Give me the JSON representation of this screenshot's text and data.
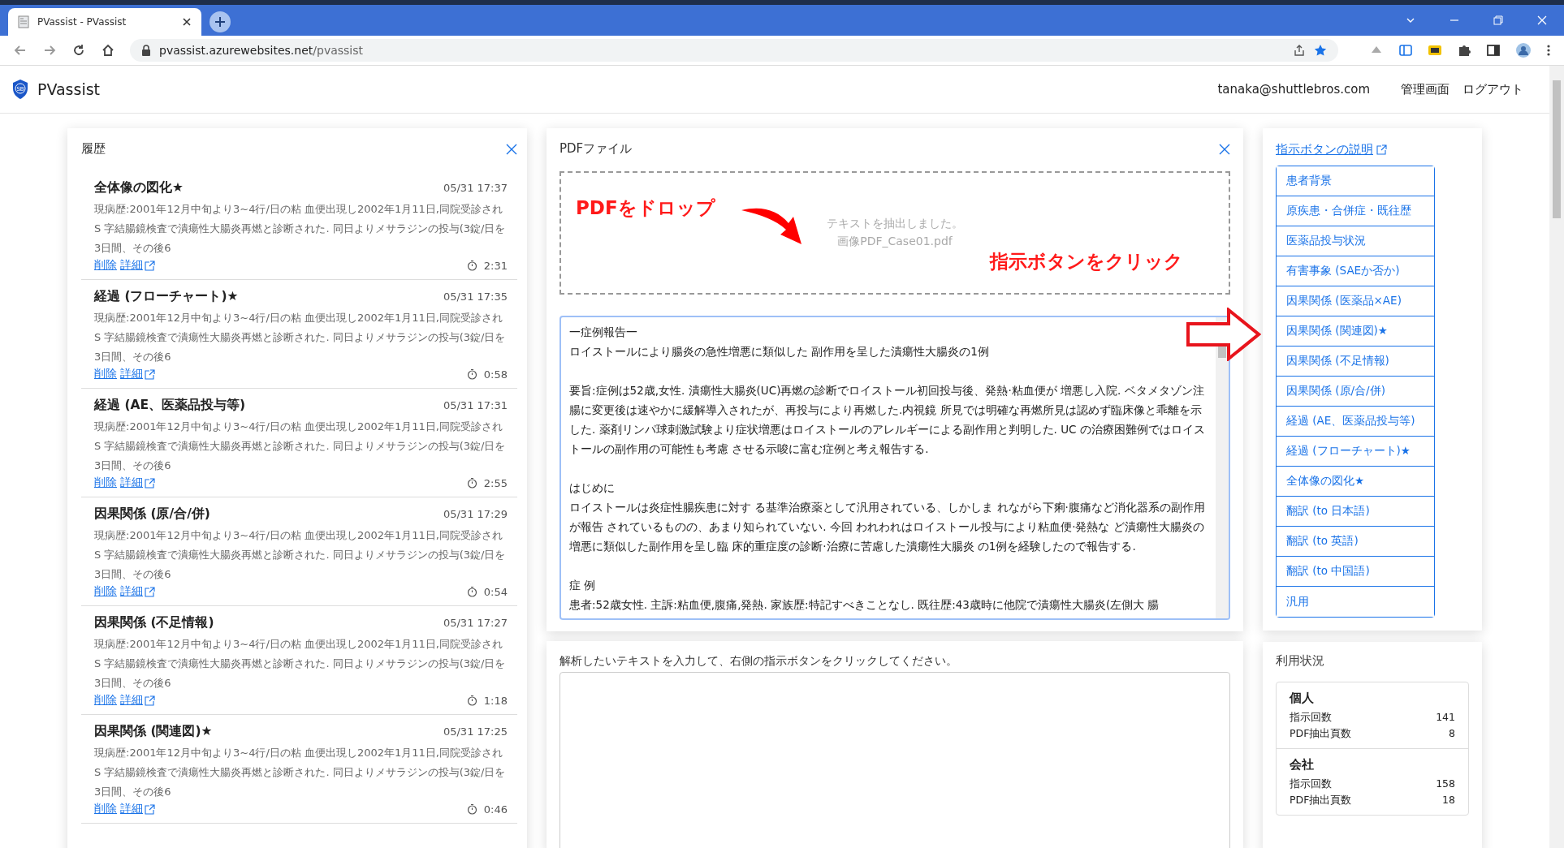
{
  "browser": {
    "tab_title": "PVassist - PVassist",
    "url_host": "pvassist.azurewebsites.net",
    "url_path": "/pvassist"
  },
  "header": {
    "logo_text": "SB",
    "app_name": "PVassist",
    "user": "tanaka@shuttlebros.com",
    "nav": [
      "管理画面",
      "ログアウト"
    ]
  },
  "history": {
    "title": "履歴",
    "items": [
      {
        "title": "全体像の図化★",
        "time": "05/31 17:37",
        "excerpt": "現病歴:2001年12月中旬より3~4行/日の粘 血便出現し2002年1月11日,同院受診され S 字結腸鏡検査で潰瘍性大腸炎再燃と診断された. 同日よりメサラジンの投与(3錠/日を3日間、その後6",
        "actions": [
          "削除",
          "詳細"
        ],
        "duration": "2:31"
      },
      {
        "title": "経過 (フローチャート)★",
        "time": "05/31 17:35",
        "excerpt": "現病歴:2001年12月中旬より3~4行/日の粘 血便出現し2002年1月11日,同院受診され S 字結腸鏡検査で潰瘍性大腸炎再燃と診断された. 同日よりメサラジンの投与(3錠/日を3日間、その後6",
        "actions": [
          "削除",
          "詳細"
        ],
        "duration": "0:58"
      },
      {
        "title": "経過 (AE、医薬品投与等)",
        "time": "05/31 17:31",
        "excerpt": "現病歴:2001年12月中旬より3~4行/日の粘 血便出現し2002年1月11日,同院受診され S 字結腸鏡検査で潰瘍性大腸炎再燃と診断された. 同日よりメサラジンの投与(3錠/日を3日間、その後6",
        "actions": [
          "削除",
          "詳細"
        ],
        "duration": "2:55"
      },
      {
        "title": "因果関係 (原/合/併)",
        "time": "05/31 17:29",
        "excerpt": "現病歴:2001年12月中旬より3~4行/日の粘 血便出現し2002年1月11日,同院受診され S 字結腸鏡検査で潰瘍性大腸炎再燃と診断された. 同日よりメサラジンの投与(3錠/日を3日間、その後6",
        "actions": [
          "削除",
          "詳細"
        ],
        "duration": "0:54"
      },
      {
        "title": "因果関係 (不足情報)",
        "time": "05/31 17:27",
        "excerpt": "現病歴:2001年12月中旬より3~4行/日の粘 血便出現し2002年1月11日,同院受診され S 字結腸鏡検査で潰瘍性大腸炎再燃と診断された. 同日よりメサラジンの投与(3錠/日を3日間、その後6",
        "actions": [
          "削除",
          "詳細"
        ],
        "duration": "1:18"
      },
      {
        "title": "因果関係 (関連図)★",
        "time": "05/31 17:25",
        "excerpt": "現病歴:2001年12月中旬より3~4行/日の粘 血便出現し2002年1月11日,同院受診され S 字結腸鏡検査で潰瘍性大腸炎再燃と診断された. 同日よりメサラジンの投与(3錠/日を3日間、その後6",
        "actions": [
          "削除",
          "詳細"
        ],
        "duration": "0:46"
      }
    ]
  },
  "pdf": {
    "title": "PDFファイル",
    "status": "テキストを抽出しました。",
    "filename": "画像PDF_Case01.pdf",
    "extracted_text": [
      [
        "一症例報告一",
        "ロイストールにより腸炎の急性増悪に類似した 副作用を呈した潰瘍性大腸炎の1例"
      ],
      [
        "要旨:症例は52歳,女性. 潰瘍性大腸炎(UC)再燃の診断でロイストール初回投与後、発熱·粘血便が 増悪し入院. ベタメタゾン注腸に変更後は速やかに緩解導入されたが、再投与により再燃した.内視鏡 所見では明確な再燃所見は認めず臨床像と乖離を示した. 薬剤リンパ球刺激試験より症状増悪はロイストールのアレルギーによる副作用と判明した. UC の治療困難例ではロイストールの副作用の可能性も考慮 させる示唆に富む症例と考え報告する."
      ],
      [
        "はじめに",
        "ロイストールは炎症性腸疾患に対す る基準治療薬として汎用されている、しかしま れながら下痢·腹痛など消化器系の副作用が報告 されているものの、あまり知られていない. 今回 われわれはロイストール投与により粘血便·発熱な ど潰瘍性大腸炎の増悪に類似した副作用を呈し臨 床的重症度の診断·治療に苦慮した潰瘍性大腸炎 の1例を経験したので報告する."
      ],
      [
        "症 例",
        "患者:52歳女性. 主訴:粘血便,腹痛,発熱. 家族歴:特記すべきことなし. 既往歴:43歳時に他院で潰瘍性大腸炎(左側大 腸"
      ]
    ]
  },
  "annotations": [
    {
      "kind": "drop",
      "text": "PDFをドロップ"
    },
    {
      "kind": "click",
      "text": "指示ボタンをクリック"
    }
  ],
  "prompt": {
    "label": "解析したいテキストを入力して、右側の指示ボタンをクリックしてください。"
  },
  "instructions": {
    "help_link": "指示ボタンの説明",
    "buttons": [
      "患者背景",
      "原疾患・合併症・既往歴",
      "医薬品投与状況",
      "有害事象 (SAEか否か)",
      "因果関係 (医薬品×AE)",
      "因果関係 (関連図)★",
      "因果関係 (不足情報)",
      "因果関係 (原/合/併)",
      "経過 (AE、医薬品投与等)",
      "経過 (フローチャート)★",
      "全体像の図化★",
      "翻訳 (to 日本語)",
      "翻訳 (to 英語)",
      "翻訳 (to 中国語)",
      "汎用"
    ]
  },
  "usage": {
    "title": "利用状況",
    "groups": [
      {
        "name": "個人",
        "rows": [
          {
            "label": "指示回数",
            "value": "141"
          },
          {
            "label": "PDF抽出頁数",
            "value": "8"
          }
        ]
      },
      {
        "name": "会社",
        "rows": [
          {
            "label": "指示回数",
            "value": "158"
          },
          {
            "label": "PDF抽出頁数",
            "value": "18"
          }
        ]
      }
    ]
  }
}
